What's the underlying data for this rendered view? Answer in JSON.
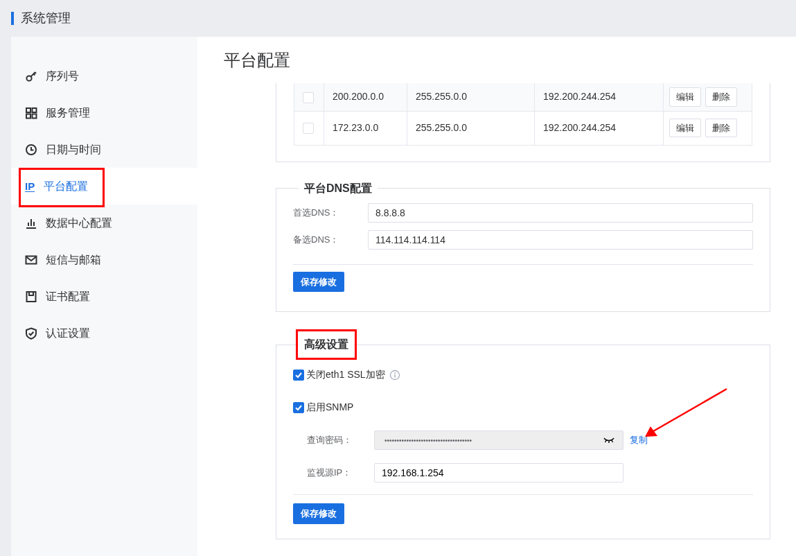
{
  "header": {
    "title": "系统管理"
  },
  "sidebar": {
    "items": [
      {
        "label": "序列号",
        "selected": false,
        "highlighted": false
      },
      {
        "label": "服务管理",
        "selected": false,
        "highlighted": false
      },
      {
        "label": "日期与时间",
        "selected": false,
        "highlighted": false
      },
      {
        "label": "平台配置",
        "icon_text": "IP",
        "selected": true,
        "highlighted": true
      },
      {
        "label": "数据中心配置",
        "selected": false,
        "highlighted": false
      },
      {
        "label": "短信与邮箱",
        "selected": false,
        "highlighted": false
      },
      {
        "label": "证书配置",
        "selected": false,
        "highlighted": false
      },
      {
        "label": "认证设置",
        "selected": false,
        "highlighted": false
      }
    ]
  },
  "page_title": "平台配置",
  "routes_table": {
    "rows": [
      {
        "checked": false,
        "cells": [
          "200.200.0.0",
          "255.255.0.0",
          "192.200.244.254"
        ],
        "actions": [
          "编辑",
          "删除"
        ]
      },
      {
        "checked": false,
        "cells": [
          "172.23.0.0",
          "255.255.0.0",
          "192.200.244.254"
        ],
        "actions": [
          "编辑",
          "删除"
        ]
      }
    ]
  },
  "dns_section": {
    "title": "平台DNS配置",
    "fields": [
      {
        "label": "首选DNS：",
        "value": "8.8.8.8"
      },
      {
        "label": "备选DNS：",
        "value": "114.114.114.114"
      }
    ],
    "save_button": "保存修改"
  },
  "advanced_section": {
    "title": "高级设置",
    "highlighted": true,
    "options": [
      {
        "label": "关闭eth1 SSL加密",
        "checked": true,
        "info": true
      },
      {
        "label": "启用SNMP",
        "checked": true
      }
    ],
    "fields": [
      {
        "kind": "password",
        "label": "查询密码：",
        "value": "••••••••••••••••••••••••••••••••••••",
        "disabled": true,
        "copy_link": "复制",
        "arrow": true
      },
      {
        "kind": "text",
        "label": "监视源IP：",
        "value": "192.168.1.254"
      }
    ],
    "save_button": "保存修改"
  }
}
